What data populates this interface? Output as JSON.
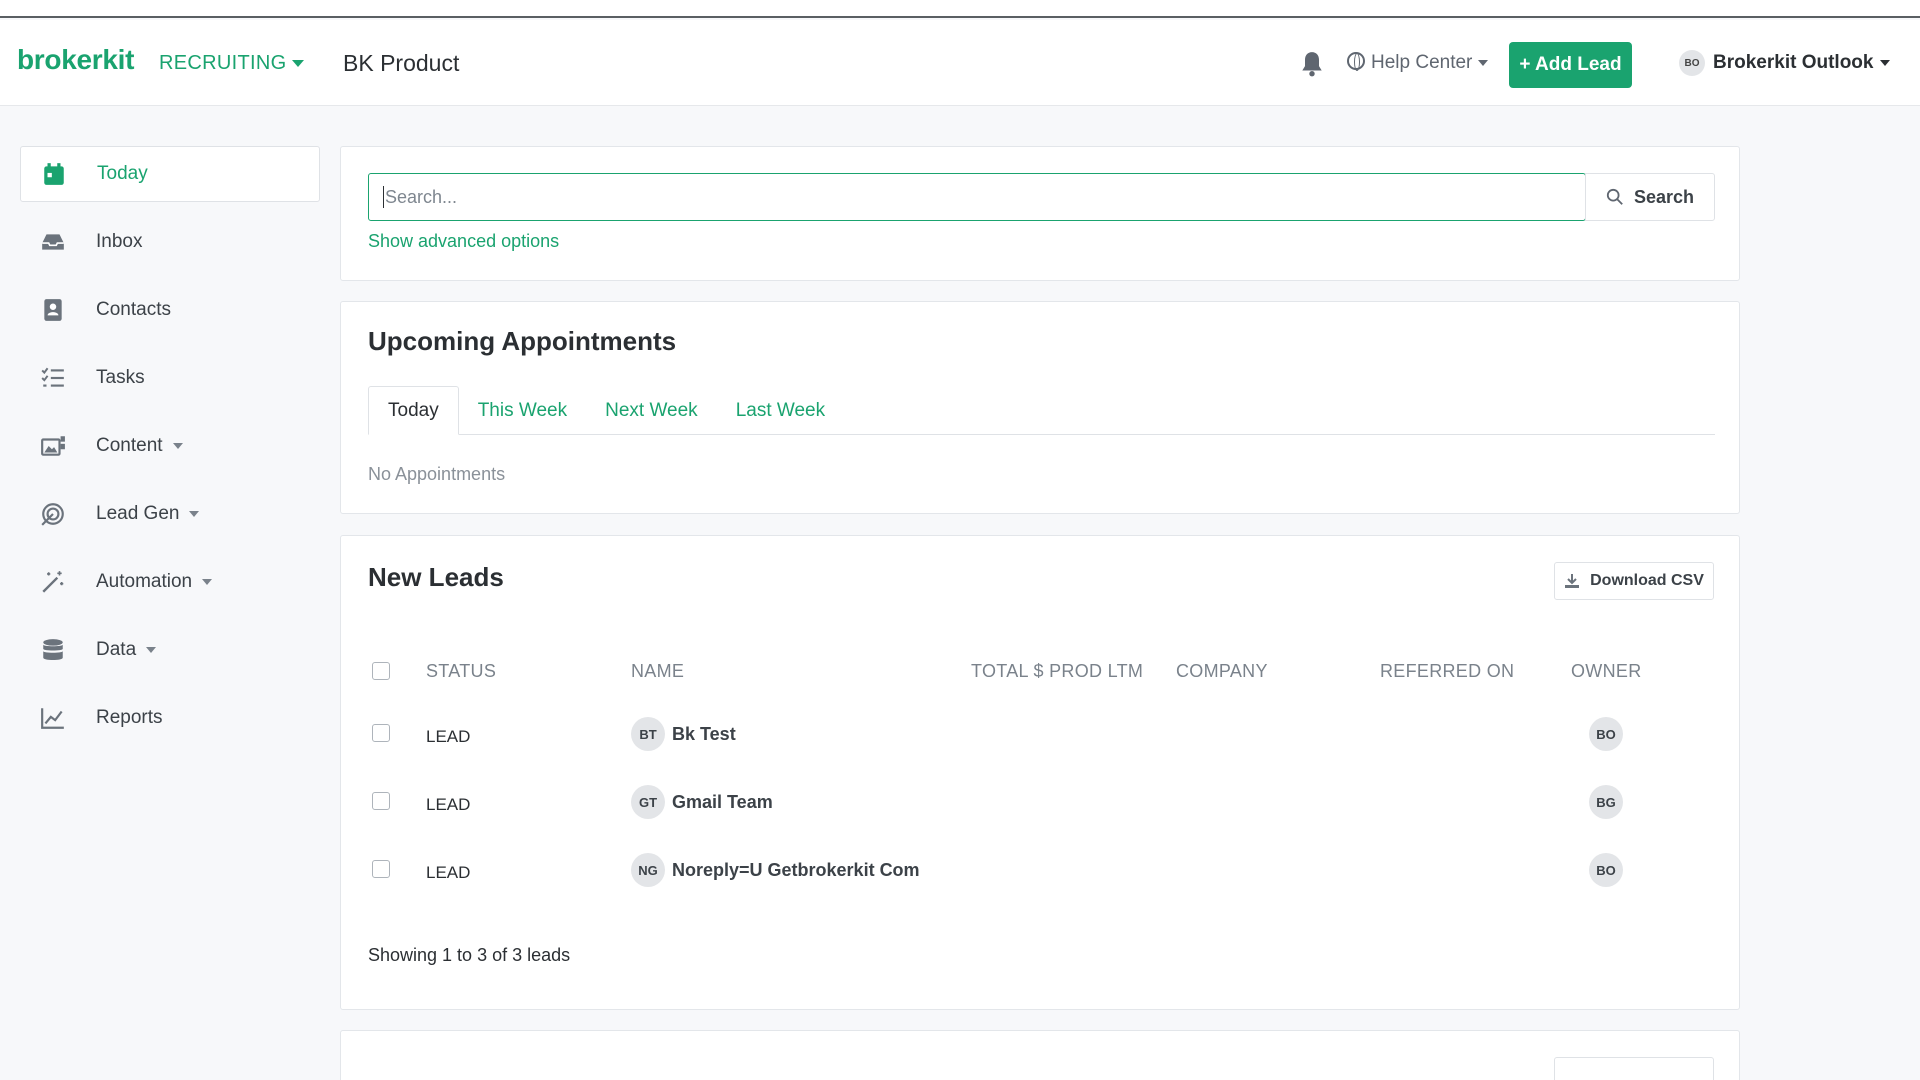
{
  "header": {
    "logo": "brokerkit",
    "workspace": "RECRUITING",
    "app_title": "BK Product",
    "help": "Help Center",
    "add_lead": "+ Add Lead",
    "user_initials": "BO",
    "user_name": "Brokerkit Outlook"
  },
  "sidebar": {
    "items": [
      {
        "label": "Today",
        "icon": "calendar-icon"
      },
      {
        "label": "Inbox",
        "icon": "inbox-icon"
      },
      {
        "label": "Contacts",
        "icon": "contacts-icon"
      },
      {
        "label": "Tasks",
        "icon": "tasks-icon"
      },
      {
        "label": "Content",
        "icon": "content-icon"
      },
      {
        "label": "Lead Gen",
        "icon": "lead-gen-icon"
      },
      {
        "label": "Automation",
        "icon": "automation-icon"
      },
      {
        "label": "Data",
        "icon": "database-icon"
      },
      {
        "label": "Reports",
        "icon": "reports-icon"
      }
    ]
  },
  "search": {
    "placeholder": "Search...",
    "button": "Search",
    "advanced": "Show advanced options"
  },
  "appointments": {
    "title": "Upcoming Appointments",
    "tabs": [
      "Today",
      "This Week",
      "Next Week",
      "Last Week"
    ],
    "empty": "No Appointments"
  },
  "leads": {
    "title": "New Leads",
    "download": "Download CSV",
    "columns": [
      "STATUS",
      "NAME",
      "TOTAL $ PROD LTM",
      "COMPANY",
      "REFERRED ON",
      "OWNER"
    ],
    "rows": [
      {
        "status": "LEAD",
        "initials": "BT",
        "name": "Bk Test",
        "owner": "BO"
      },
      {
        "status": "LEAD",
        "initials": "GT",
        "name": "Gmail Team",
        "owner": "BG"
      },
      {
        "status": "LEAD",
        "initials": "NG",
        "name": "Noreply=U Getbrokerkit Com",
        "owner": "BO"
      }
    ],
    "showing": "Showing 1 to 3 of 3 leads"
  },
  "colors": {
    "accent": "#1aa36f",
    "text": "#2b2f33",
    "muted": "#7a828b"
  }
}
